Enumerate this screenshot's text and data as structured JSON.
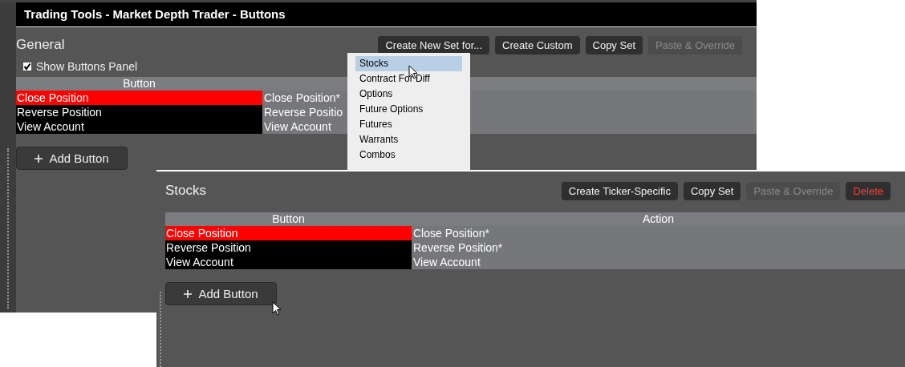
{
  "back_window": {
    "title": "Trading Tools - Market Depth Trader - Buttons",
    "section_title": "General",
    "toolbar": [
      {
        "label": "Create New Set for...",
        "disabled": false
      },
      {
        "label": "Create Custom",
        "disabled": false
      },
      {
        "label": "Copy Set",
        "disabled": false
      },
      {
        "label": "Paste & Override",
        "disabled": true
      }
    ],
    "show_panel": {
      "label": "Show Buttons Panel",
      "checked": true
    },
    "table": {
      "columns": [
        "Button"
      ],
      "rows": [
        {
          "button": "Close Position",
          "color": "#ff0000",
          "action": "Close Position*"
        },
        {
          "button": "Reverse Position",
          "color": "#000000",
          "action": "Reverse Positio"
        },
        {
          "button": "View Account",
          "color": "#000000",
          "action": "View Account"
        }
      ]
    },
    "add_button": "Add Button",
    "dropdown": {
      "items": [
        {
          "label": "Stocks",
          "selected": true
        },
        {
          "label": "Contract For Diff",
          "selected": false
        },
        {
          "label": "Options",
          "selected": false
        },
        {
          "label": "Future Options",
          "selected": false
        },
        {
          "label": "Futures",
          "selected": false
        },
        {
          "label": "Warrants",
          "selected": false
        },
        {
          "label": "Combos",
          "selected": false
        }
      ]
    }
  },
  "front_window": {
    "section_title": "Stocks",
    "toolbar": [
      {
        "label": "Create Ticker-Specific",
        "disabled": false,
        "kind": "normal"
      },
      {
        "label": "Copy Set",
        "disabled": false,
        "kind": "normal"
      },
      {
        "label": "Paste & Override",
        "disabled": true,
        "kind": "normal"
      },
      {
        "label": "Delete",
        "disabled": false,
        "kind": "danger"
      }
    ],
    "table": {
      "columns": [
        "Button",
        "Action"
      ],
      "rows": [
        {
          "button": "Close Position",
          "color": "#ff0000",
          "action": "Close Position*"
        },
        {
          "button": "Reverse Position",
          "color": "#000000",
          "action": "Reverse Position*"
        },
        {
          "button": "View Account",
          "color": "#000000",
          "action": "View Account"
        }
      ]
    },
    "add_button": "Add Button"
  }
}
